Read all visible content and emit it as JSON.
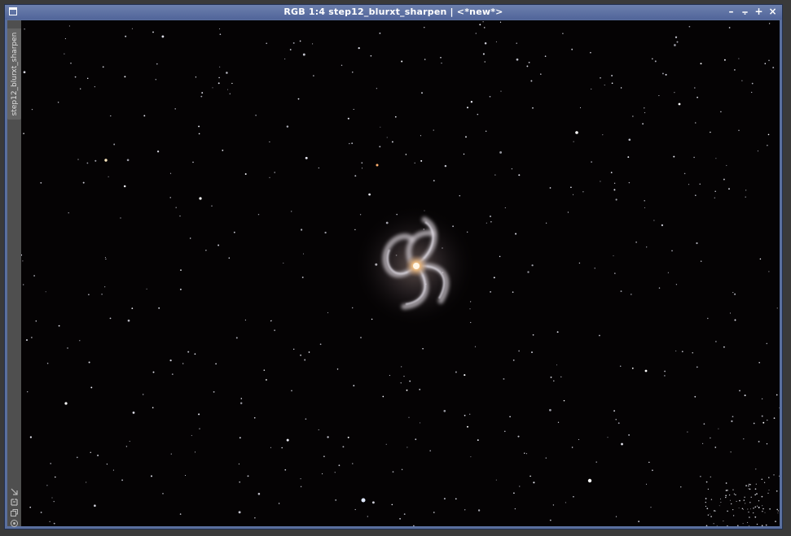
{
  "window": {
    "title": "RGB 1:4 step12_blurxt_sharpen | <*new*>",
    "controls": [
      {
        "name": "minimize",
        "glyph": "–"
      },
      {
        "name": "shade",
        "glyph": "⨪"
      },
      {
        "name": "maximize",
        "glyph": "+"
      },
      {
        "name": "close",
        "glyph": "×"
      }
    ]
  },
  "sidebar": {
    "tab_label": "step12_blurxt_sharpen",
    "icons": [
      "arrow-diagonal-icon",
      "mask-icon",
      "copy-icon",
      "target-icon"
    ]
  },
  "image": {
    "subject": "spiral-galaxy",
    "background_color": "#050304",
    "frame_color": "#5a6f9e"
  }
}
